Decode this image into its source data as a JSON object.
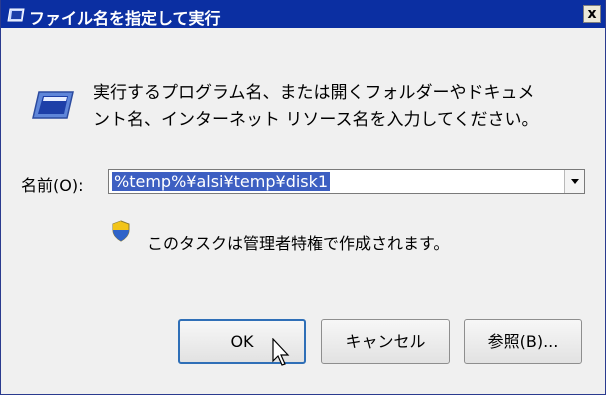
{
  "window": {
    "title": "ファイル名を指定して実行",
    "close_glyph": "x"
  },
  "dialog": {
    "description_line1": "実行するプログラム名、または開くフォルダーやドキュメ",
    "description_line2": "ント名、インターネット リソース名を入力してください。",
    "name_label": "名前(O):",
    "name_value": "%temp%¥alsi¥temp¥disk1",
    "admin_note": "このタスクは管理者特権で作成されます。"
  },
  "buttons": {
    "ok": "OK",
    "cancel": "キャンセル",
    "browse": "参照(B)..."
  },
  "icons": {
    "title": "run-window-icon",
    "run": "run-window-icon",
    "shield": "uac-shield-icon",
    "cursor": "mouse-pointer-icon"
  },
  "colors": {
    "titlebar": "#0b2fa2",
    "selection": "#3d5fc2",
    "ok_border": "#2f6fb7",
    "dialog_bg": "#f0f0f0"
  }
}
